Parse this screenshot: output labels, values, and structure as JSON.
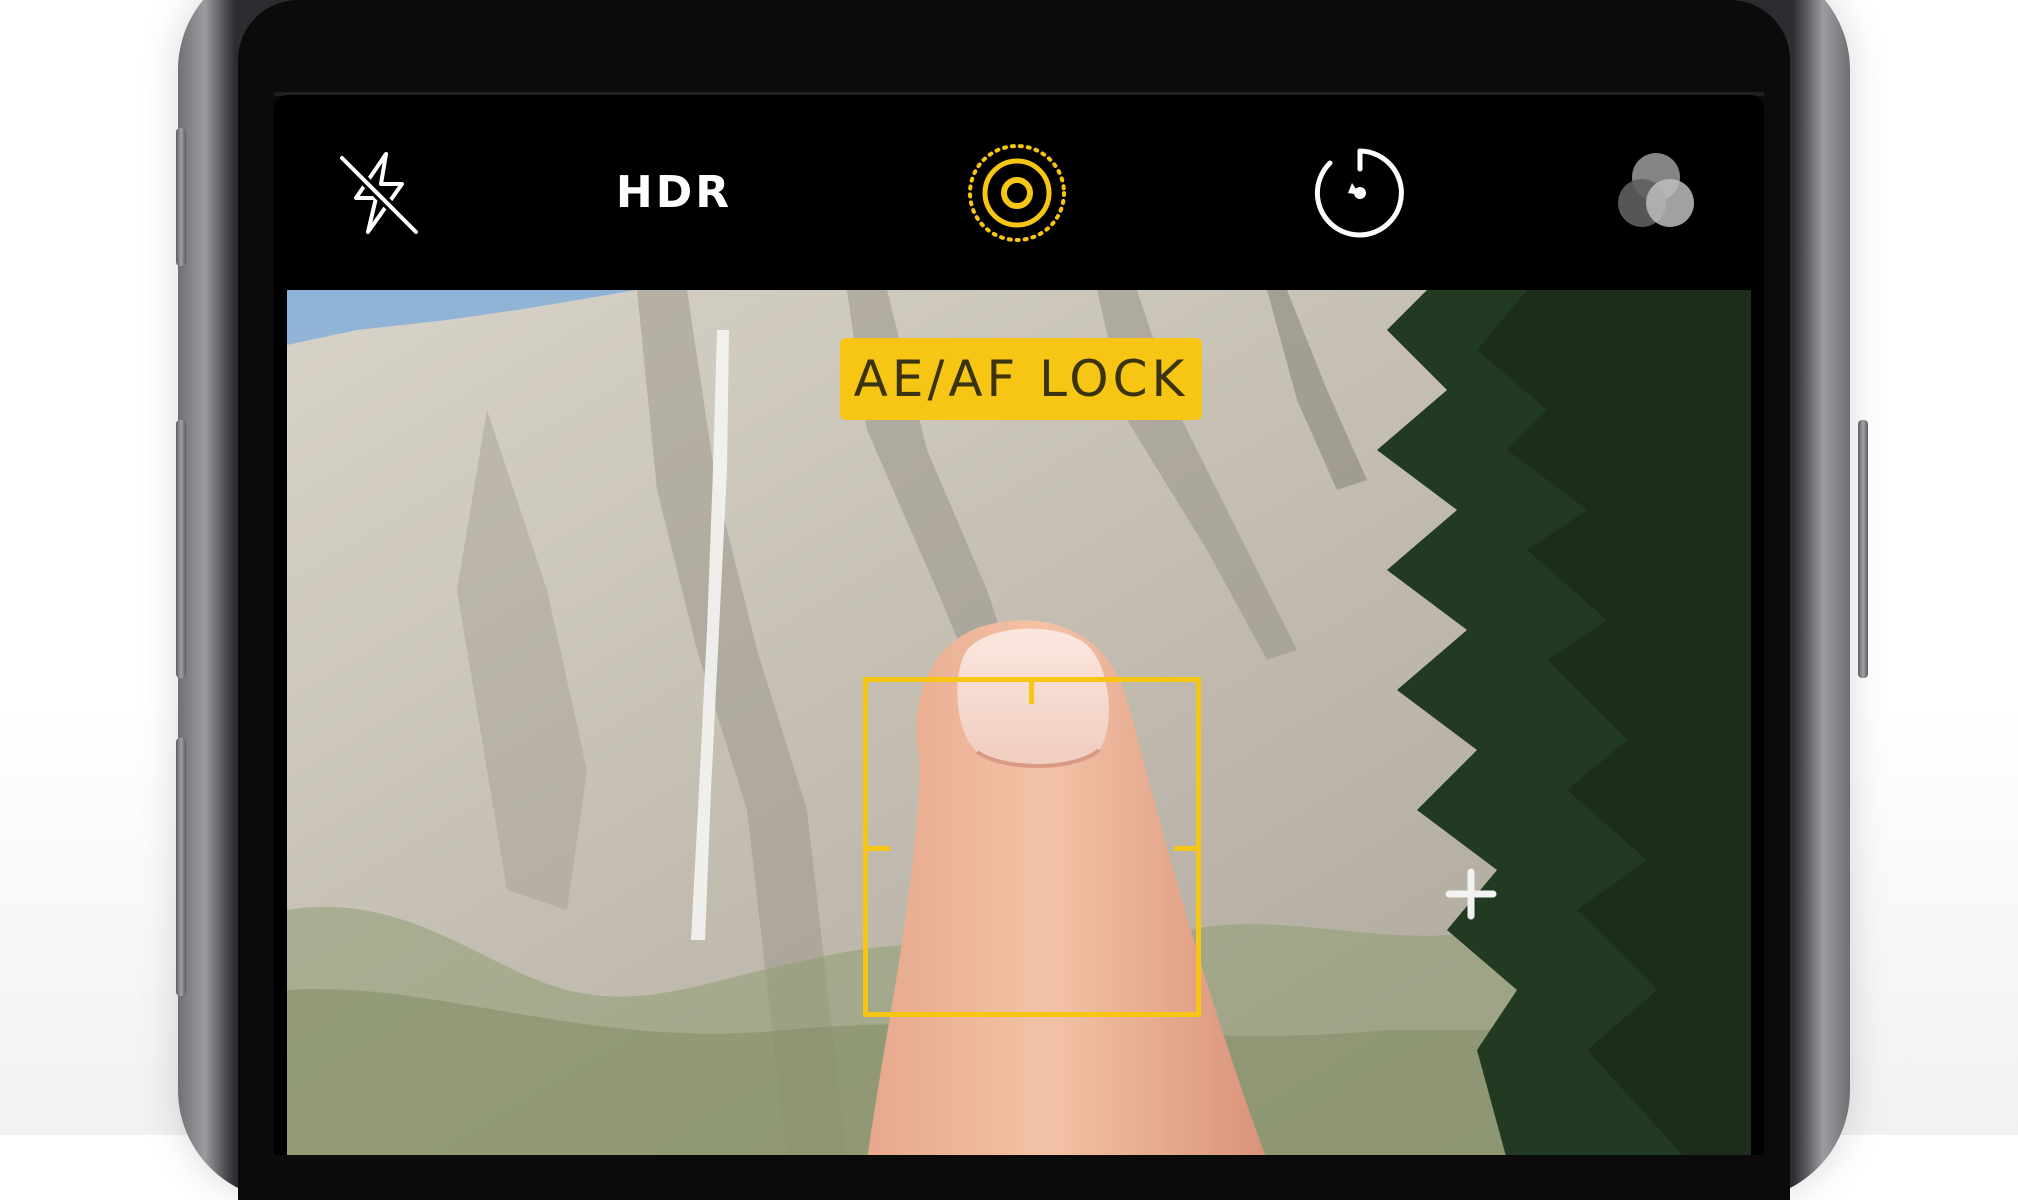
{
  "camera": {
    "top_bar": {
      "flash": {
        "icon": "flash-off-icon",
        "state": "off"
      },
      "hdr_label": "HDR",
      "live_photo": {
        "icon": "live-photo-icon",
        "state": "on"
      },
      "timer": {
        "icon": "timer-icon"
      },
      "filters": {
        "icon": "filters-icon"
      }
    },
    "viewfinder": {
      "lock_badge": "AE/AF LOCK",
      "focus_indicator": "focus-box",
      "exposure_icon": "plus-crosshair-icon"
    }
  },
  "colors": {
    "accent_yellow": "#f7c615",
    "topbar_bg": "#000000",
    "icon_white": "#ffffff"
  }
}
